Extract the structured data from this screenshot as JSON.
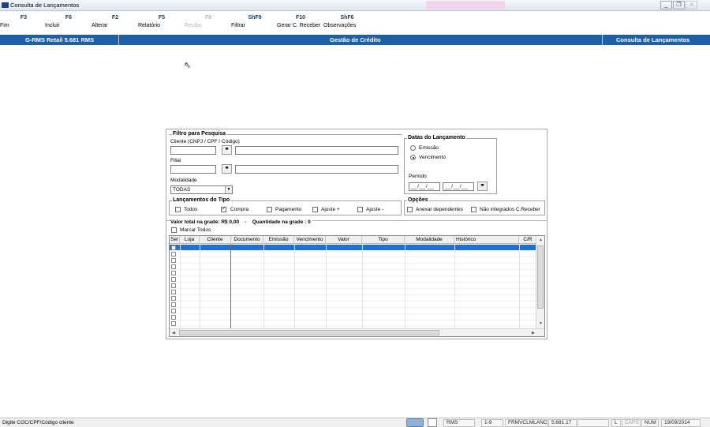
{
  "window": {
    "title": "Consulta de Lançamentos",
    "controls": [
      "minimize",
      "restore",
      "close"
    ]
  },
  "toolbar": [
    {
      "key": "F3",
      "label": "Fim",
      "enabled": true
    },
    {
      "key": "F6",
      "label": "Incluir",
      "enabled": true
    },
    {
      "key": "F2",
      "label": "Alterar",
      "enabled": true
    },
    {
      "key": "F5",
      "label": "Relatório",
      "enabled": true
    },
    {
      "key": "F8",
      "label": "Recibo",
      "enabled": false
    },
    {
      "key": "ShF9",
      "label": "Filtrar",
      "enabled": true
    },
    {
      "key": "F10",
      "label": "Gerar C. Receber",
      "enabled": true
    },
    {
      "key": "ShF6",
      "label": "Observações",
      "enabled": true
    }
  ],
  "header": {
    "left": "G-RMS Retail 5.681 RMS",
    "center": "Gestão de Crédito",
    "right": "Consulta de Lançamentos"
  },
  "filter": {
    "title": "Filtro para Pesquisa",
    "cliente_label": "Cliente (CNPJ / CPF / Código)",
    "filial_label": "Filial",
    "modalidade_label": "Modalidade",
    "modalidade_value": "TODAS"
  },
  "datas": {
    "title": "Datas do Lançamento",
    "emissao": "Emissão",
    "vencimento": "Vencimento",
    "periodo": "Período",
    "date_from": "__/__/__",
    "date_to": "__/__/__"
  },
  "tipo": {
    "title": "Lançamentos do Tipo",
    "items": [
      {
        "label": "Todos",
        "checked": false
      },
      {
        "label": "Compra",
        "checked": true
      },
      {
        "label": "Pagamento",
        "checked": false
      },
      {
        "label": "Ajuste +",
        "checked": false
      },
      {
        "label": "Ajuste -",
        "checked": false
      }
    ]
  },
  "opcoes": {
    "title": "Opções",
    "anexar": "Anexar dependentes",
    "nao_integrados": "Não integrados C.Receber"
  },
  "totals": {
    "valor_label": "Valor total na grade:",
    "valor_value": "R$ 0,00",
    "sep": "-",
    "quantidade_label": "Quantidade na grade :",
    "quantidade_value": "0",
    "marcar_todos": "Marcar Todos"
  },
  "grid": {
    "columns": [
      "Sel",
      "Loja",
      "Cliente",
      "Documento",
      "Emissão",
      "Vencimento",
      "Valor",
      "Tipo",
      "Modalidade",
      "Histórico",
      "C/R"
    ],
    "rows": 13
  },
  "statusbar": {
    "message": "Digite CGC/CPF/Código cliente",
    "user": "RMS",
    "position": "1-9",
    "form": "FRMVCLMLANC",
    "version": "5.681.17",
    "l": "L",
    "caps": "CAPS",
    "num": "NUM",
    "date": "19/09/2014"
  },
  "colors": {
    "header_blue": "#1f5fa6",
    "selection_blue": "#1f6fd6",
    "toolbar_key": "#17375e"
  }
}
